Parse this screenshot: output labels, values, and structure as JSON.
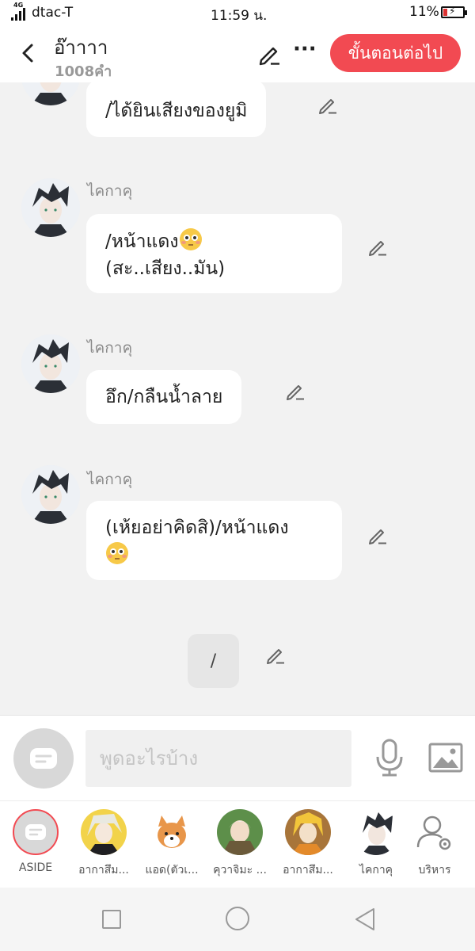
{
  "status": {
    "network": "4G",
    "carrier": "dtac-T",
    "time": "11:59 น.",
    "battery": "11%"
  },
  "header": {
    "title": "อ๊าาาา",
    "subtitle": "1008คำ",
    "next_label": "ขั้นตอนต่อไป",
    "more_label": "···"
  },
  "messages": [
    {
      "speaker": "",
      "text": "/ได้ยินเสียงของยูมิ"
    },
    {
      "speaker": "ไคกาคุ",
      "line1": "/หน้าแดง",
      "line2": "(สะ..เสียง..มัน)"
    },
    {
      "speaker": "ไคกาคุ",
      "text": "อึก/กลืนน้ำลาย"
    },
    {
      "speaker": "ไคกาคุ",
      "line1": "(เห้ยอย่าคิดสิ)/หน้าแดง"
    },
    {
      "speaker": "",
      "text": "/"
    }
  ],
  "input": {
    "placeholder": "พูดอะไรบ้าง"
  },
  "characters": [
    {
      "label": "ASIDE"
    },
    {
      "label": "อากาสึม..."
    },
    {
      "label": "แอด(ตัวเ..."
    },
    {
      "label": "คุวาจิมะ ..."
    },
    {
      "label": "อากาสึม..."
    },
    {
      "label": "ไคกาคุ"
    },
    {
      "label": "บริหาร"
    }
  ],
  "colors": {
    "accent": "#f24a52",
    "background": "#f2f2f2",
    "bubble": "#ffffff",
    "speaker": "#8a8a8a"
  },
  "icons": [
    "back-arrow-icon",
    "pencil-icon",
    "more-icon",
    "mic-icon",
    "image-icon",
    "aside-chat-icon",
    "user-gear-icon",
    "blushing-emoji-icon"
  ]
}
